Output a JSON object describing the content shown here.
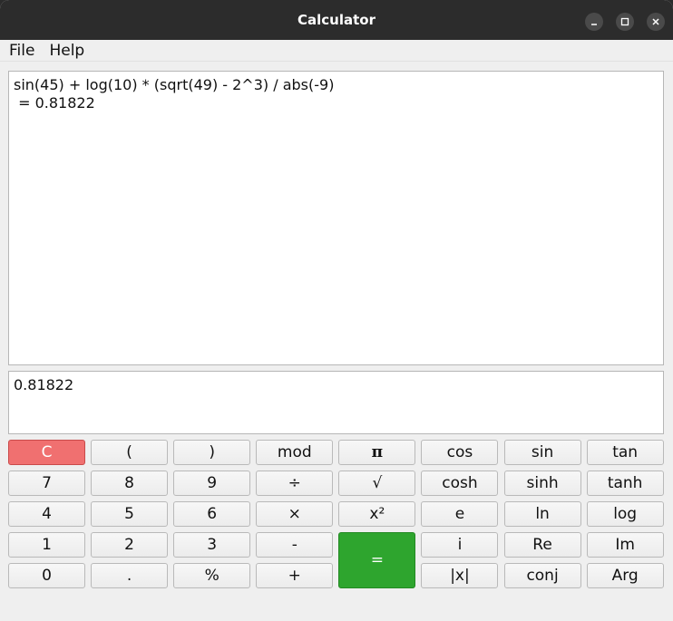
{
  "window": {
    "title": "Calculator"
  },
  "menu": {
    "file": "File",
    "help": "Help"
  },
  "history": {
    "expression": "sin(45) + log(10) * (sqrt(49) - 2^3) / abs(-9)",
    "result_line": " = 0.81822"
  },
  "input": {
    "value": "0.81822"
  },
  "keys": [
    {
      "label": "C",
      "name": "clear-button"
    },
    {
      "label": "(",
      "name": "open-paren-button"
    },
    {
      "label": ")",
      "name": "close-paren-button"
    },
    {
      "label": "mod",
      "name": "mod-button"
    },
    {
      "label": "π",
      "name": "pi-button"
    },
    {
      "label": "cos",
      "name": "cos-button"
    },
    {
      "label": "sin",
      "name": "sin-button"
    },
    {
      "label": "tan",
      "name": "tan-button"
    },
    {
      "label": "7",
      "name": "digit-7-button"
    },
    {
      "label": "8",
      "name": "digit-8-button"
    },
    {
      "label": "9",
      "name": "digit-9-button"
    },
    {
      "label": "÷",
      "name": "divide-button"
    },
    {
      "label": "√",
      "name": "sqrt-button"
    },
    {
      "label": "cosh",
      "name": "cosh-button"
    },
    {
      "label": "sinh",
      "name": "sinh-button"
    },
    {
      "label": "tanh",
      "name": "tanh-button"
    },
    {
      "label": "4",
      "name": "digit-4-button"
    },
    {
      "label": "5",
      "name": "digit-5-button"
    },
    {
      "label": "6",
      "name": "digit-6-button"
    },
    {
      "label": "×",
      "name": "multiply-button"
    },
    {
      "label": "x²",
      "name": "square-button"
    },
    {
      "label": "e",
      "name": "e-button"
    },
    {
      "label": "ln",
      "name": "ln-button"
    },
    {
      "label": "log",
      "name": "log-button"
    },
    {
      "label": "1",
      "name": "digit-1-button"
    },
    {
      "label": "2",
      "name": "digit-2-button"
    },
    {
      "label": "3",
      "name": "digit-3-button"
    },
    {
      "label": "-",
      "name": "minus-button"
    },
    {
      "label": "=",
      "name": "equals-button"
    },
    {
      "label": "i",
      "name": "imaginary-button"
    },
    {
      "label": "Re",
      "name": "real-part-button"
    },
    {
      "label": "Im",
      "name": "imag-part-button"
    },
    {
      "label": "0",
      "name": "digit-0-button"
    },
    {
      "label": ".",
      "name": "decimal-button"
    },
    {
      "label": "%",
      "name": "percent-button"
    },
    {
      "label": "+",
      "name": "plus-button"
    },
    {
      "label": "|x|",
      "name": "abs-button"
    },
    {
      "label": "conj",
      "name": "conj-button"
    },
    {
      "label": "Arg",
      "name": "arg-button"
    }
  ],
  "colors": {
    "clear_button": "#f07070",
    "equals_button": "#2ea52e",
    "titlebar": "#2c2c2c"
  },
  "icons": {
    "minimize": "minimize-icon",
    "maximize": "maximize-icon",
    "close": "close-icon"
  }
}
